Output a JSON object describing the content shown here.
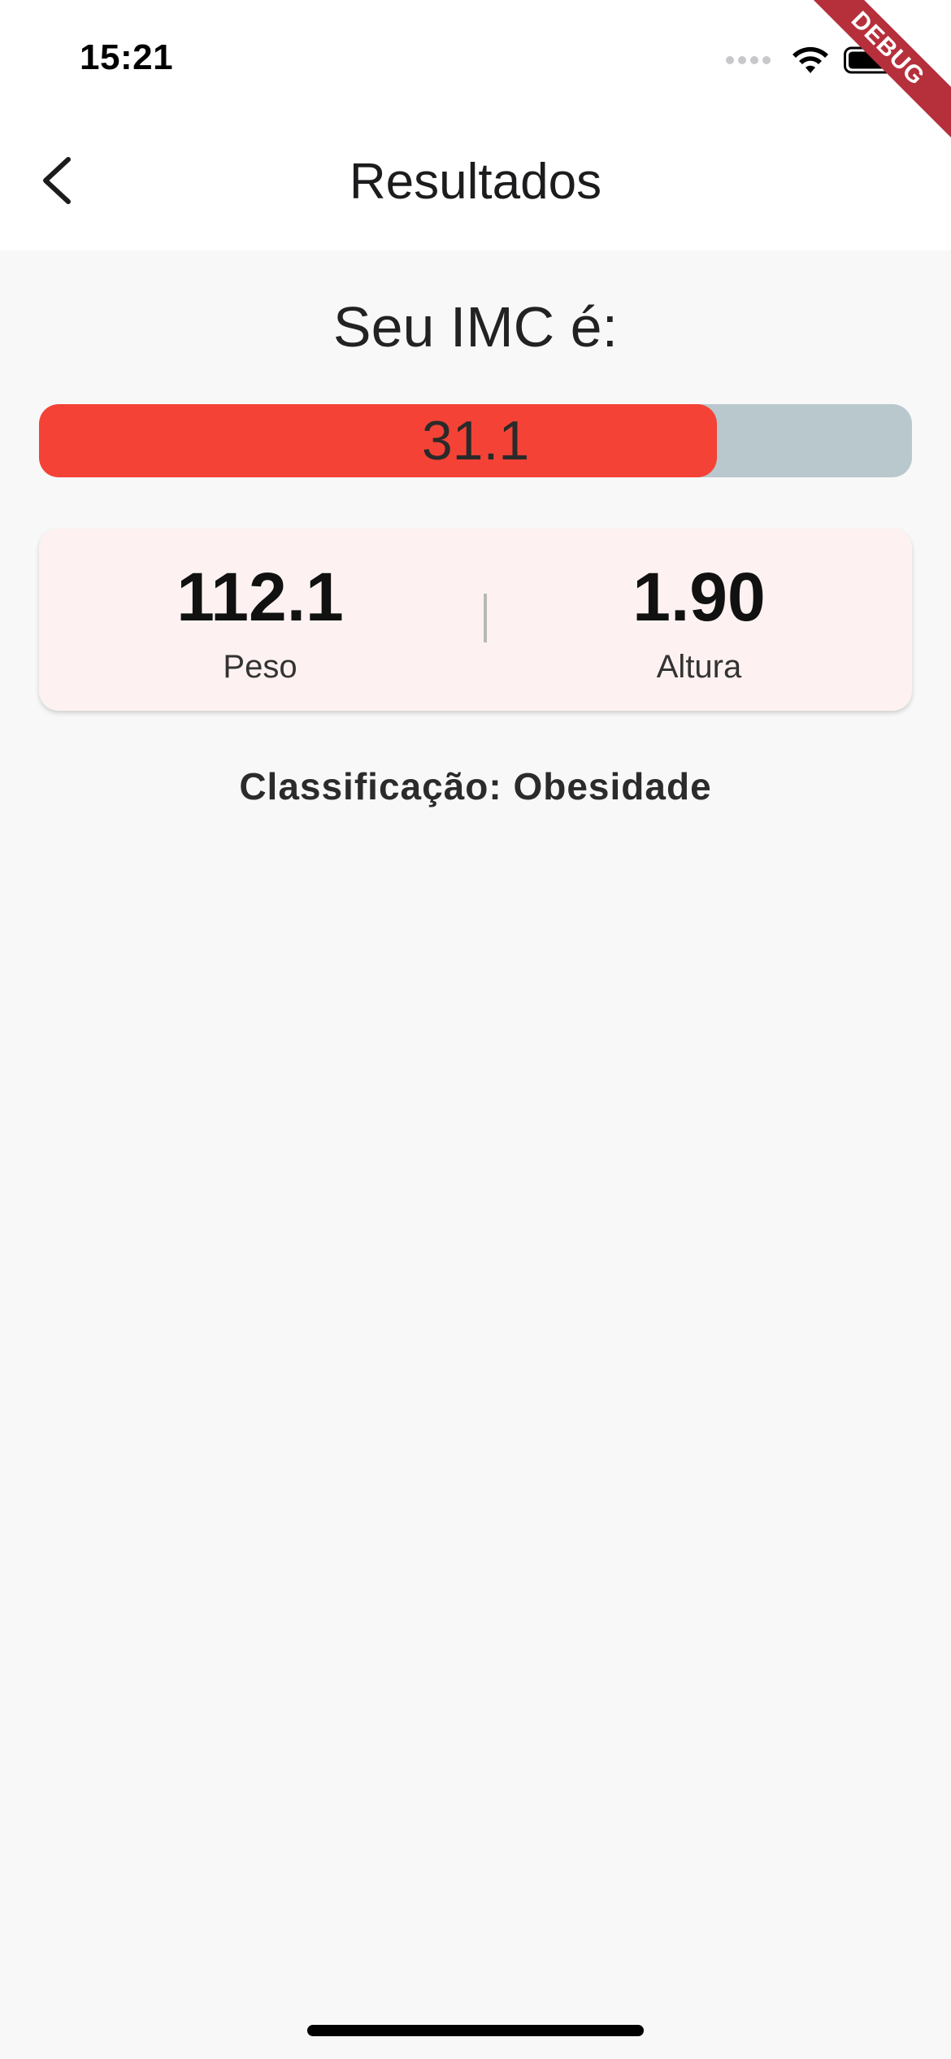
{
  "status_bar": {
    "time": "15:21",
    "icons": [
      "signal-icon",
      "wifi-icon",
      "battery-icon"
    ]
  },
  "debug_banner": {
    "label": "DEBUG",
    "color": "#b5303b"
  },
  "app_bar": {
    "title": "Resultados",
    "back_icon": "chevron-left-icon"
  },
  "result": {
    "heading": "Seu IMC é:",
    "bmi_value": "31.1",
    "bmi_progress": 0.777,
    "bar_fill_color": "#f44336",
    "bar_track_color": "#b9c8cd"
  },
  "info_card": {
    "weight_value": "112.1",
    "weight_label": "Peso",
    "height_value": "1.90",
    "height_label": "Altura",
    "background_color": "#fdf2f1"
  },
  "classification": "Classificação: Obesidade"
}
